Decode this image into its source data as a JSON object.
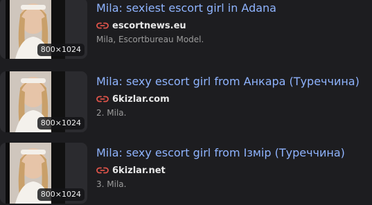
{
  "colors": {
    "background": "#1d1d20",
    "title_link": "#8fb4ff",
    "domain_text": "#e8e8e8",
    "description_text": "#9c9c9c",
    "link_icon": "#e0544a"
  },
  "results": [
    {
      "title": "Mila: sexiest escort girl in Adana",
      "domain": "escortnews.eu",
      "description": "Mila, Escortbureau Model.",
      "image_size": "800×1024",
      "icon": "link-icon"
    },
    {
      "title": "Mila: sexy escort girl from Анкара (Туреччина)",
      "domain": "6kizlar.com",
      "description": "2. Mila.",
      "image_size": "800×1024",
      "icon": "link-icon"
    },
    {
      "title": "Mila: sexy escort girl from Ізмір (Туреччина)",
      "domain": "6kizlar.net",
      "description": "3. Mila.",
      "image_size": "800×1024",
      "icon": "link-icon"
    }
  ]
}
